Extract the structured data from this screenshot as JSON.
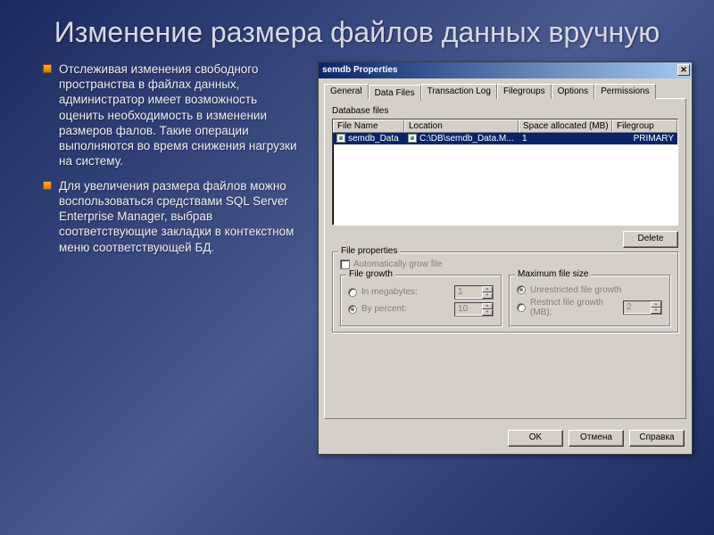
{
  "slide": {
    "title": "Изменение размера файлов данных вручную",
    "bullets": [
      "Отслеживая изменения свободного пространства в файлах данных, администратор имеет возможность оценить необходимость в изменении размеров фалов. Такие операции выполняются во время снижения нагрузки на систему.",
      "Для увеличения размера файлов можно воспользоваться средствами SQL Server Enterprise Manager, выбрав соответствующие закладки в контекстном меню соответствующей БД."
    ]
  },
  "dialog": {
    "title": "semdb Properties",
    "tabs": [
      "General",
      "Data Files",
      "Transaction Log",
      "Filegroups",
      "Options",
      "Permissions"
    ],
    "active_tab": "Data Files",
    "section_label": "Database files",
    "columns": {
      "c1": "File Name",
      "c2": "Location",
      "c3": "Space allocated (MB)",
      "c4": "Filegroup"
    },
    "row": {
      "filename": "semdb_Data",
      "location": "C:\\DB\\semdb_Data.M...",
      "space": "1",
      "filegroup": "PRIMARY"
    },
    "delete_btn": "Delete",
    "fileprops": {
      "title": "File properties",
      "autogrow": "Automatically grow file",
      "growth": {
        "title": "File growth",
        "mb_label": "In megabytes:",
        "mb_value": "1",
        "pct_label": "By percent:",
        "pct_value": "10"
      },
      "maxsize": {
        "title": "Maximum file size",
        "unrestricted": "Unrestricted file growth",
        "restrict_label": "Restrict file growth (MB):",
        "restrict_value": "2"
      }
    },
    "buttons": {
      "ok": "OK",
      "cancel": "Отмена",
      "help": "Справка"
    }
  }
}
